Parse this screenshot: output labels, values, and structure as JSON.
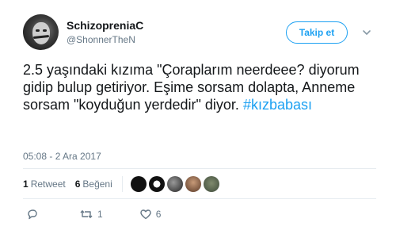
{
  "tweet": {
    "display_name": "SchizopreniaC",
    "handle": "@ShonnerTheN",
    "follow_label": "Takip et",
    "text": "2.5 yaşındaki kızıma \"Çoraplarım neerdeee? diyorum gidip bulup getiriyor. Eşime sorsam dolapta, Anneme sorsam \"koyduğun yerdedir\" diyor.",
    "hashtag": "#kızbabası",
    "timestamp": "05:08 - 2 Ara 2017",
    "stats": {
      "retweet_count": "1",
      "retweet_label": "Retweet",
      "like_count": "6",
      "like_label": "Beğeni"
    },
    "actions": {
      "reply_count": "",
      "retweet_count": "1",
      "like_count": "6"
    }
  },
  "colors": {
    "accent": "#1da1f2",
    "text": "#14171a",
    "muted": "#657786",
    "separator": "#e6ecf0"
  },
  "icons": [
    "chevron-down-icon",
    "reply-icon",
    "retweet-icon",
    "like-icon"
  ]
}
